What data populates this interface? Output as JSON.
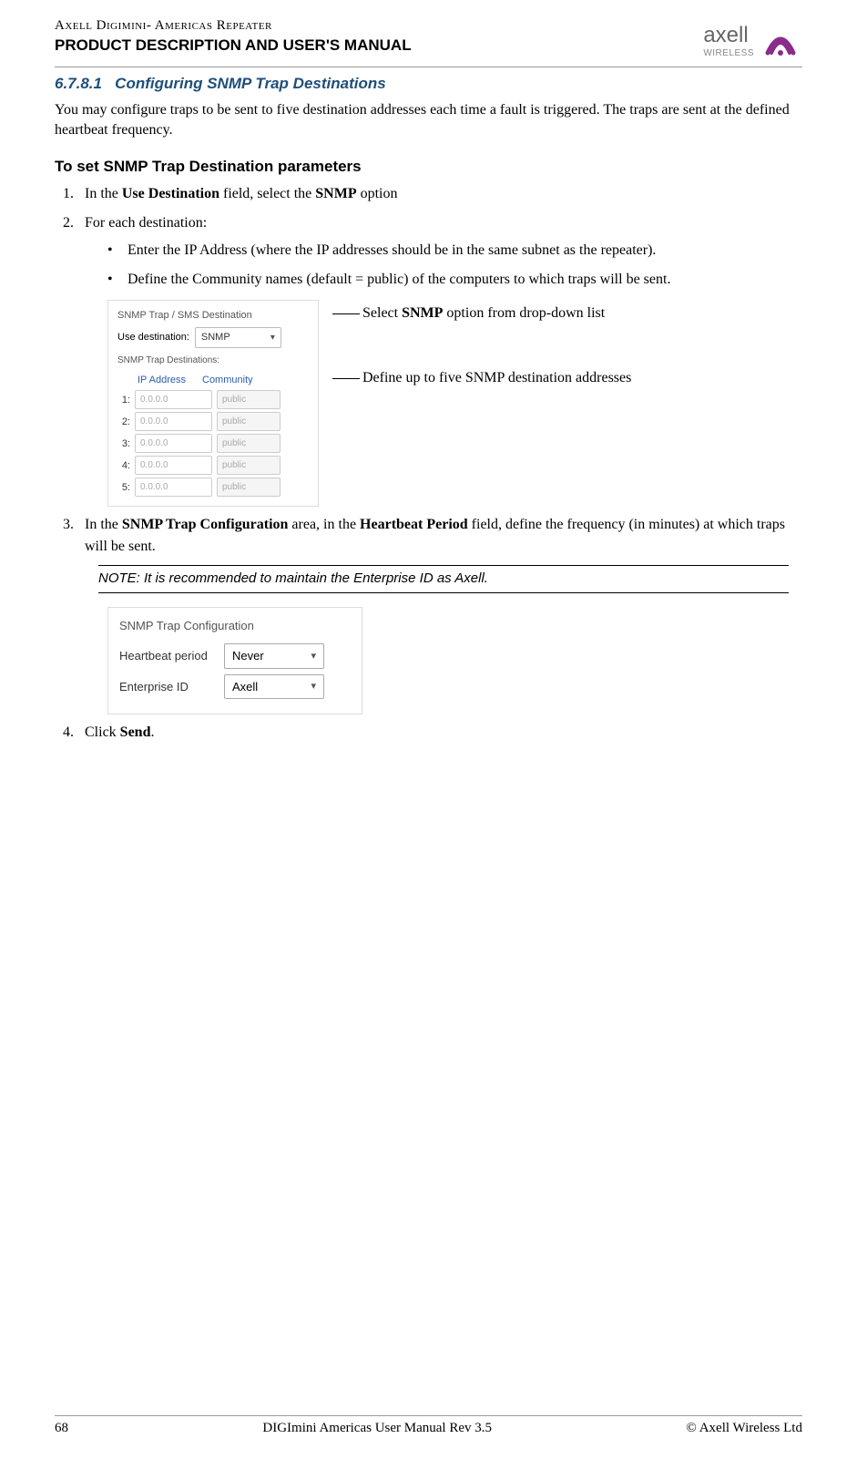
{
  "header": {
    "line1": "Axell Digimini- Americas Repeater",
    "line2": "PRODUCT DESCRIPTION AND USER'S MANUAL",
    "logo_text": "axell",
    "logo_sub": "WIRELESS"
  },
  "section": {
    "number": "6.7.8.1",
    "title": "Configuring SNMP Trap Destinations"
  },
  "intro": "You may configure traps to be sent to five destination addresses each time a fault is triggered. The traps are sent at the defined heartbeat frequency.",
  "subheading": "To set SNMP Trap Destination parameters",
  "steps": {
    "s1_pre": "In the ",
    "s1_bold1": "Use Destination",
    "s1_mid": " field, select the ",
    "s1_bold2": "SNMP",
    "s1_post": " option",
    "s2": "For each destination:",
    "s2_bullets": [
      "Enter the IP Address (where the IP addresses should be in the same subnet as the repeater).",
      "Define the Community names (default = public) of the computers to which traps will be sent."
    ],
    "s3_pre": "In the ",
    "s3_bold1": "SNMP Trap Configuration",
    "s3_mid1": " area, in the ",
    "s3_bold2": "Heartbeat Period",
    "s3_post": " field, define the frequency (in minutes) at which traps will be sent.",
    "s4_pre": "Click ",
    "s4_bold": "Send",
    "s4_post": "."
  },
  "figure1": {
    "title": "SNMP Trap / SMS Destination",
    "use_dest_label": "Use destination:",
    "use_dest_value": "SNMP",
    "traps_label": "SNMP Trap Destinations:",
    "col1": "IP Address",
    "col2": "Community",
    "rows": [
      {
        "n": "1:",
        "ip": "0.0.0.0",
        "comm": "public"
      },
      {
        "n": "2:",
        "ip": "0.0.0.0",
        "comm": "public"
      },
      {
        "n": "3:",
        "ip": "0.0.0.0",
        "comm": "public"
      },
      {
        "n": "4:",
        "ip": "0.0.0.0",
        "comm": "public"
      },
      {
        "n": "5:",
        "ip": "0.0.0.0",
        "comm": "public"
      }
    ]
  },
  "annotations": {
    "a1_pre": "Select ",
    "a1_bold": "SNMP",
    "a1_post": " option from drop-down list",
    "a2": "Define up to five SNMP destination addresses"
  },
  "note": "NOTE: It is recommended to maintain the Enterprise ID as Axell.",
  "figure2": {
    "title": "SNMP Trap Configuration",
    "row1_label": "Heartbeat period",
    "row1_value": "Never",
    "row2_label": "Enterprise ID",
    "row2_value": "Axell"
  },
  "footer": {
    "page": "68",
    "center": "DIGImini Americas User Manual Rev 3.5",
    "right": "© Axell Wireless Ltd"
  }
}
